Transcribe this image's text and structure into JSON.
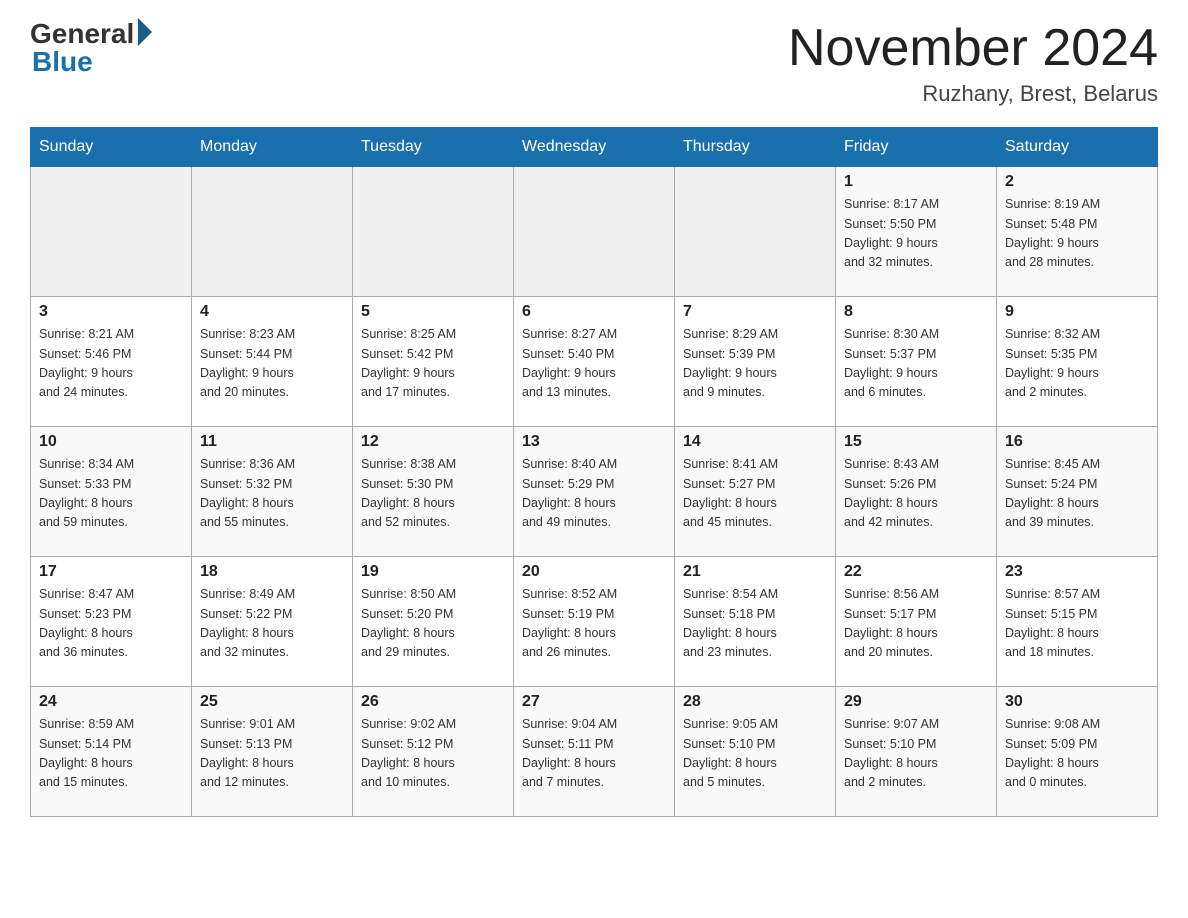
{
  "header": {
    "logo_general": "General",
    "logo_blue": "Blue",
    "month_title": "November 2024",
    "location": "Ruzhany, Brest, Belarus"
  },
  "days_of_week": [
    "Sunday",
    "Monday",
    "Tuesday",
    "Wednesday",
    "Thursday",
    "Friday",
    "Saturday"
  ],
  "weeks": [
    [
      {
        "day": "",
        "info": ""
      },
      {
        "day": "",
        "info": ""
      },
      {
        "day": "",
        "info": ""
      },
      {
        "day": "",
        "info": ""
      },
      {
        "day": "",
        "info": ""
      },
      {
        "day": "1",
        "info": "Sunrise: 8:17 AM\nSunset: 5:50 PM\nDaylight: 9 hours\nand 32 minutes."
      },
      {
        "day": "2",
        "info": "Sunrise: 8:19 AM\nSunset: 5:48 PM\nDaylight: 9 hours\nand 28 minutes."
      }
    ],
    [
      {
        "day": "3",
        "info": "Sunrise: 8:21 AM\nSunset: 5:46 PM\nDaylight: 9 hours\nand 24 minutes."
      },
      {
        "day": "4",
        "info": "Sunrise: 8:23 AM\nSunset: 5:44 PM\nDaylight: 9 hours\nand 20 minutes."
      },
      {
        "day": "5",
        "info": "Sunrise: 8:25 AM\nSunset: 5:42 PM\nDaylight: 9 hours\nand 17 minutes."
      },
      {
        "day": "6",
        "info": "Sunrise: 8:27 AM\nSunset: 5:40 PM\nDaylight: 9 hours\nand 13 minutes."
      },
      {
        "day": "7",
        "info": "Sunrise: 8:29 AM\nSunset: 5:39 PM\nDaylight: 9 hours\nand 9 minutes."
      },
      {
        "day": "8",
        "info": "Sunrise: 8:30 AM\nSunset: 5:37 PM\nDaylight: 9 hours\nand 6 minutes."
      },
      {
        "day": "9",
        "info": "Sunrise: 8:32 AM\nSunset: 5:35 PM\nDaylight: 9 hours\nand 2 minutes."
      }
    ],
    [
      {
        "day": "10",
        "info": "Sunrise: 8:34 AM\nSunset: 5:33 PM\nDaylight: 8 hours\nand 59 minutes."
      },
      {
        "day": "11",
        "info": "Sunrise: 8:36 AM\nSunset: 5:32 PM\nDaylight: 8 hours\nand 55 minutes."
      },
      {
        "day": "12",
        "info": "Sunrise: 8:38 AM\nSunset: 5:30 PM\nDaylight: 8 hours\nand 52 minutes."
      },
      {
        "day": "13",
        "info": "Sunrise: 8:40 AM\nSunset: 5:29 PM\nDaylight: 8 hours\nand 49 minutes."
      },
      {
        "day": "14",
        "info": "Sunrise: 8:41 AM\nSunset: 5:27 PM\nDaylight: 8 hours\nand 45 minutes."
      },
      {
        "day": "15",
        "info": "Sunrise: 8:43 AM\nSunset: 5:26 PM\nDaylight: 8 hours\nand 42 minutes."
      },
      {
        "day": "16",
        "info": "Sunrise: 8:45 AM\nSunset: 5:24 PM\nDaylight: 8 hours\nand 39 minutes."
      }
    ],
    [
      {
        "day": "17",
        "info": "Sunrise: 8:47 AM\nSunset: 5:23 PM\nDaylight: 8 hours\nand 36 minutes."
      },
      {
        "day": "18",
        "info": "Sunrise: 8:49 AM\nSunset: 5:22 PM\nDaylight: 8 hours\nand 32 minutes."
      },
      {
        "day": "19",
        "info": "Sunrise: 8:50 AM\nSunset: 5:20 PM\nDaylight: 8 hours\nand 29 minutes."
      },
      {
        "day": "20",
        "info": "Sunrise: 8:52 AM\nSunset: 5:19 PM\nDaylight: 8 hours\nand 26 minutes."
      },
      {
        "day": "21",
        "info": "Sunrise: 8:54 AM\nSunset: 5:18 PM\nDaylight: 8 hours\nand 23 minutes."
      },
      {
        "day": "22",
        "info": "Sunrise: 8:56 AM\nSunset: 5:17 PM\nDaylight: 8 hours\nand 20 minutes."
      },
      {
        "day": "23",
        "info": "Sunrise: 8:57 AM\nSunset: 5:15 PM\nDaylight: 8 hours\nand 18 minutes."
      }
    ],
    [
      {
        "day": "24",
        "info": "Sunrise: 8:59 AM\nSunset: 5:14 PM\nDaylight: 8 hours\nand 15 minutes."
      },
      {
        "day": "25",
        "info": "Sunrise: 9:01 AM\nSunset: 5:13 PM\nDaylight: 8 hours\nand 12 minutes."
      },
      {
        "day": "26",
        "info": "Sunrise: 9:02 AM\nSunset: 5:12 PM\nDaylight: 8 hours\nand 10 minutes."
      },
      {
        "day": "27",
        "info": "Sunrise: 9:04 AM\nSunset: 5:11 PM\nDaylight: 8 hours\nand 7 minutes."
      },
      {
        "day": "28",
        "info": "Sunrise: 9:05 AM\nSunset: 5:10 PM\nDaylight: 8 hours\nand 5 minutes."
      },
      {
        "day": "29",
        "info": "Sunrise: 9:07 AM\nSunset: 5:10 PM\nDaylight: 8 hours\nand 2 minutes."
      },
      {
        "day": "30",
        "info": "Sunrise: 9:08 AM\nSunset: 5:09 PM\nDaylight: 8 hours\nand 0 minutes."
      }
    ]
  ]
}
